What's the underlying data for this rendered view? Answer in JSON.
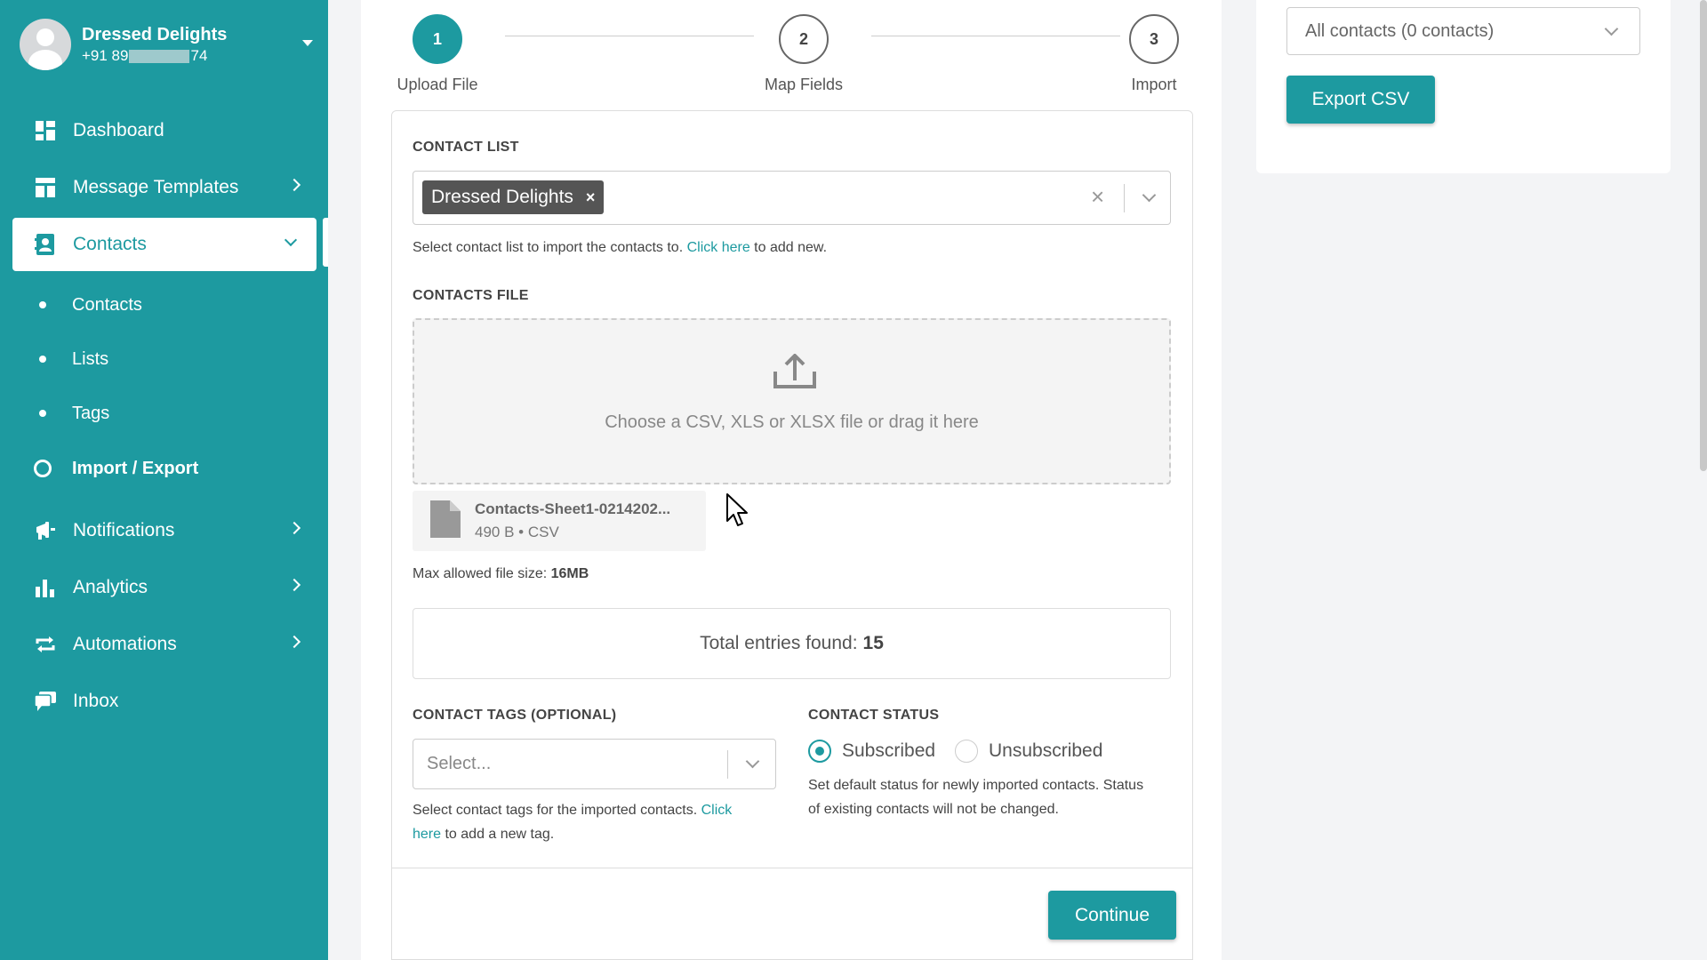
{
  "profile": {
    "name": "Dressed Delights",
    "phone_prefix": "+91 89",
    "phone_suffix": "74"
  },
  "sidebar": {
    "items": [
      {
        "label": "Dashboard",
        "icon": "dashboard-icon"
      },
      {
        "label": "Message Templates",
        "icon": "template-icon"
      },
      {
        "label": "Contacts",
        "icon": "contacts-icon"
      },
      {
        "label": "Notifications",
        "icon": "megaphone-icon"
      },
      {
        "label": "Analytics",
        "icon": "bar-chart-icon"
      },
      {
        "label": "Automations",
        "icon": "repeat-icon"
      },
      {
        "label": "Inbox",
        "icon": "chat-icon"
      }
    ],
    "contacts_sub": [
      "Contacts",
      "Lists",
      "Tags",
      "Import / Export"
    ]
  },
  "stepper": {
    "steps": [
      {
        "number": "1",
        "label": "Upload File"
      },
      {
        "number": "2",
        "label": "Map Fields"
      },
      {
        "number": "3",
        "label": "Import"
      }
    ]
  },
  "form": {
    "contact_list_label": "CONTACT LIST",
    "contact_list_value": "Dressed Delights",
    "contact_list_chip_remove": "×",
    "contact_list_clear": "×",
    "contact_list_help_before": "Select contact list to import the contacts to. ",
    "contact_list_help_link": "Click here",
    "contact_list_help_after": " to add new.",
    "contacts_file_label": "CONTACTS FILE",
    "dropzone_text": "Choose a CSV, XLS or XLSX file or drag it here",
    "file_name": "Contacts-Sheet1-0214202...",
    "file_meta": "490 B • CSV",
    "max_size_label": "Max allowed file size: ",
    "max_size_value": "16MB",
    "total_entries_label": "Total entries found:",
    "total_entries_value": "15",
    "tags_label": "CONTACT TAGS (OPTIONAL)",
    "tags_placeholder": "Select...",
    "tags_help_before": "Select contact tags for the imported contacts. ",
    "tags_help_link_1": "Click",
    "tags_help_link_2": "here",
    "tags_help_after": " to add a new tag.",
    "status_label": "CONTACT STATUS",
    "status_options": [
      "Subscribed",
      "Unsubscribed"
    ],
    "status_selected": "Subscribed",
    "status_help_1": "Set default status for newly imported contacts. Status",
    "status_help_2": "of existing contacts will not be changed.",
    "continue_label": "Continue"
  },
  "export": {
    "select_value": "All contacts (0 contacts)",
    "button_label": "Export CSV"
  },
  "colors": {
    "brand": "#1d9aa0",
    "chip": "#555555"
  }
}
